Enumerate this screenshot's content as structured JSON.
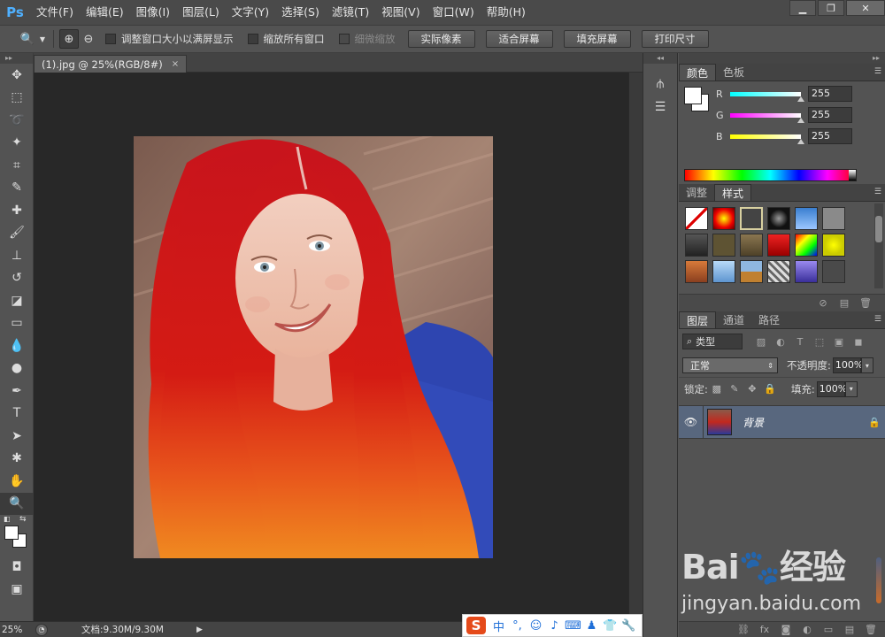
{
  "app": {
    "logo": "Ps"
  },
  "menu": [
    "文件(F)",
    "编辑(E)",
    "图像(I)",
    "图层(L)",
    "文字(Y)",
    "选择(S)",
    "滤镜(T)",
    "视图(V)",
    "窗口(W)",
    "帮助(H)"
  ],
  "window_controls": {
    "minimize": "▁",
    "restore": "❐",
    "close": "✕"
  },
  "options": {
    "zoom_tool_icon": "magnifier-icon",
    "checkbox_resize": "调整窗口大小以满屏显示",
    "checkbox_zoom_all": "缩放所有窗口",
    "checkbox_scrubby": "细微缩放",
    "btn_actual_pixels": "实际像素",
    "btn_fit_screen": "适合屏幕",
    "btn_fill_screen": "填充屏幕",
    "btn_print_size": "打印尺寸"
  },
  "document": {
    "tab_title": "(1).jpg @ 25%(RGB/8#)",
    "tab_close": "×",
    "zoom": "25%",
    "doc_size": "文档:9.30M/9.30M"
  },
  "color_panel": {
    "tabs": [
      "颜色",
      "色板"
    ],
    "r_label": "R",
    "r_value": "255",
    "g_label": "G",
    "g_value": "255",
    "b_label": "B",
    "b_value": "255"
  },
  "styles_panel": {
    "tabs": [
      "调整",
      "样式"
    ]
  },
  "layers_panel": {
    "tabs": [
      "图层",
      "通道",
      "路径"
    ],
    "filter_type": "类型",
    "blend_mode": "正常",
    "opacity_label": "不透明度:",
    "opacity_value": "100%",
    "lock_label": "锁定:",
    "fill_label": "填充:",
    "fill_value": "100%",
    "layer_name": "背景"
  },
  "ime": {
    "logo": "S",
    "items": [
      "中",
      "°,",
      "☺",
      "♪",
      "⌨",
      "♟",
      "👕",
      "🔧"
    ]
  },
  "watermark": {
    "logo": "Bai🐾经验",
    "url": "jingyan.baidu.com"
  },
  "colors": {
    "ps_blue": "#4fb0ff",
    "layer_selected": "#58677e",
    "ime_logo": "#e54a1a"
  }
}
